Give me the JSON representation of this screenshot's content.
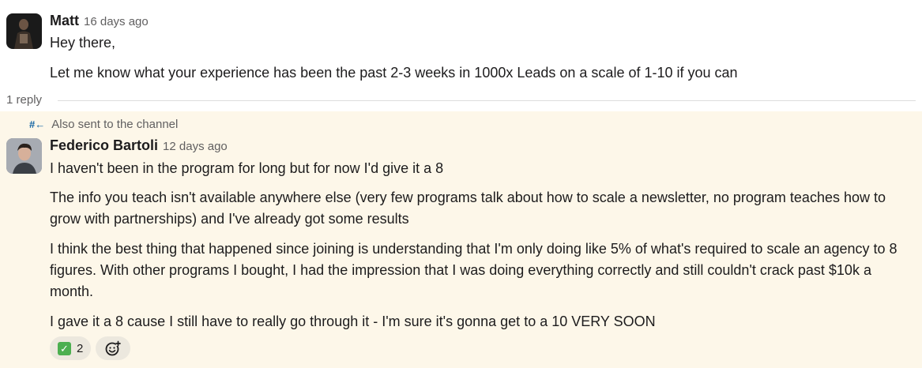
{
  "message1": {
    "author": "Matt",
    "time": "16 days ago",
    "lines": [
      "Hey there,",
      "Let me know what your experience has been the past 2-3 weeks in 1000x Leads on a scale of 1-10 if you can"
    ]
  },
  "thread": {
    "reply_count": "1 reply"
  },
  "message2": {
    "also_sent": "Also sent to the channel",
    "also_sent_icon": "#←",
    "author": "Federico Bartoli",
    "time": "12 days ago",
    "paragraphs": [
      "I haven't been in the program for long but for now I'd give it a 8",
      "The info you teach isn't available anywhere else (very few programs talk about how to scale a newsletter, no program teaches how to grow with partnerships) and I've already got some results",
      "I think the best thing that happened since joining is understanding that I'm only doing like 5% of what's required to scale an agency to 8 figures. With other programs I bought, I had the impression that I was doing everything correctly and still couldn't crack past $10k a month.",
      "I gave it a 8 cause I still have to really go through it - I'm sure it's gonna get to a 10 VERY SOON"
    ],
    "reactions": [
      {
        "emoji": "white-check-mark-icon",
        "count": "2"
      }
    ],
    "add_reaction_icon": "add-emoji-icon"
  },
  "colors": {
    "highlight_bg": "#fdf7e9",
    "reaction_bg": "#ece8de",
    "muted_text": "#616061",
    "link_blue": "#1264a3"
  }
}
